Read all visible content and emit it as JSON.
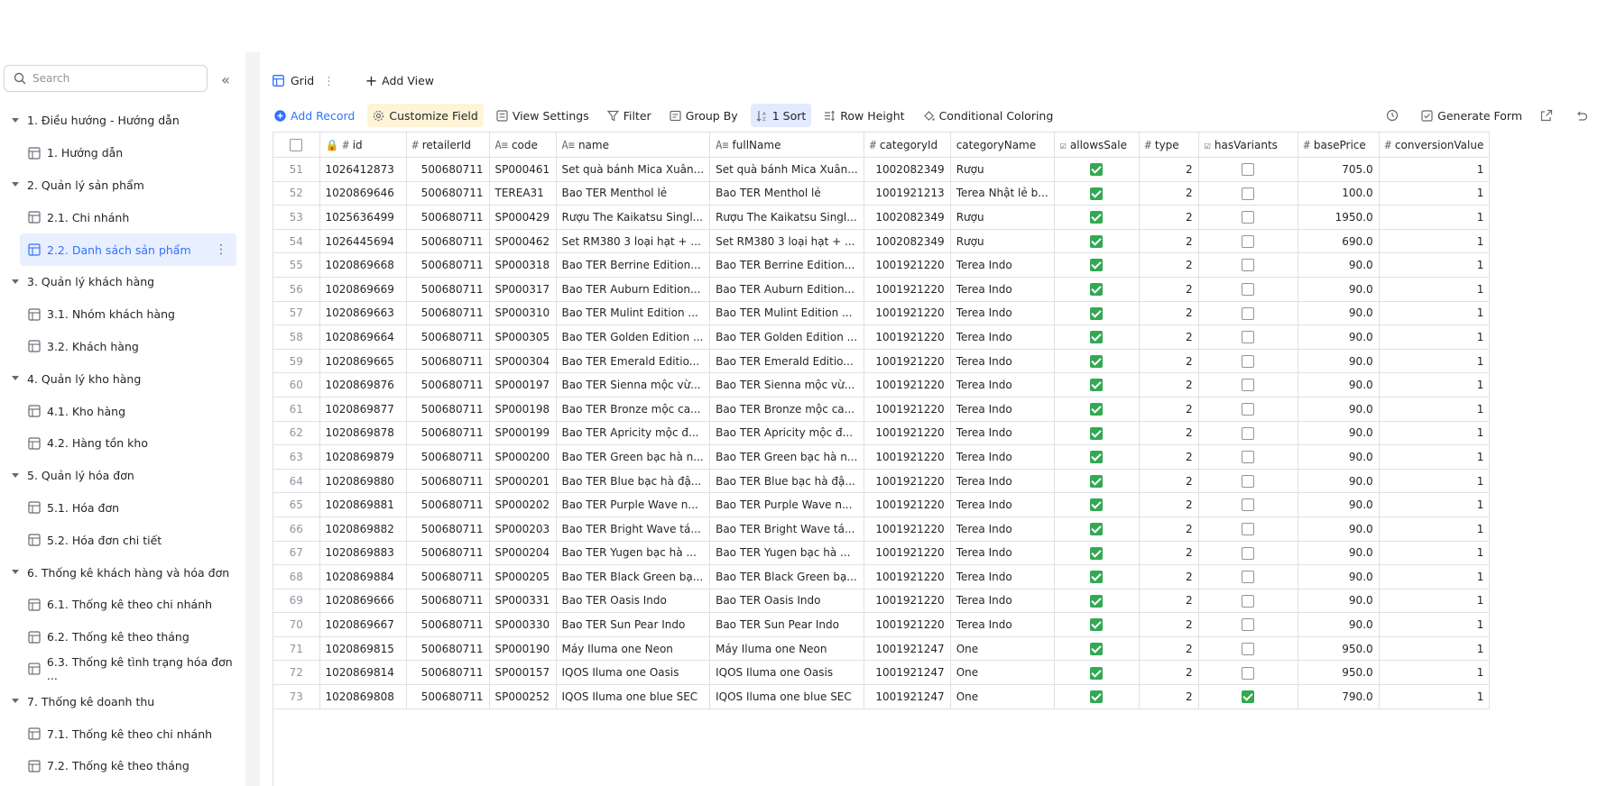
{
  "sidebar": {
    "search_placeholder": "Search",
    "groups": [
      {
        "label": "1. Điều hướng - Hướng dẫn",
        "items": [
          "1. Hướng dẫn"
        ]
      },
      {
        "label": "2. Quản lý sản phẩm",
        "items": [
          "2.1. Chi nhánh",
          "2.2. Danh sách sản phẩm"
        ]
      },
      {
        "label": "3. Quản lý khách hàng",
        "items": [
          "3.1. Nhóm khách hàng",
          "3.2. Khách hàng"
        ]
      },
      {
        "label": "4. Quản lý kho hàng",
        "items": [
          "4.1. Kho hàng",
          "4.2. Hàng tồn kho"
        ]
      },
      {
        "label": "5. Quản lý hóa đơn",
        "items": [
          "5.1. Hóa đơn",
          "5.2. Hóa đơn chi tiết"
        ]
      },
      {
        "label": "6. Thống kê khách hàng và hóa đơn",
        "items": [
          "6.1. Thống kê theo chi nhánh",
          "6.2. Thống kê theo tháng",
          "6.3. Thống kê tình trạng hóa đơn ..."
        ]
      },
      {
        "label": "7. Thống kê doanh thu",
        "items": [
          "7.1. Thống kê theo chi nhánh",
          "7.2. Thống kê theo tháng"
        ]
      }
    ],
    "active_item": "2.2. Danh sách sản phẩm"
  },
  "tabs": {
    "grid": "Grid",
    "add_view": "Add View"
  },
  "toolbar": {
    "add_record": "Add Record",
    "customize_field": "Customize Field",
    "view_settings": "View Settings",
    "filter": "Filter",
    "group_by": "Group By",
    "sort": "1 Sort",
    "row_height": "Row Height",
    "conditional_coloring": "Conditional Coloring",
    "generate_form": "Generate Form"
  },
  "columns": [
    "id",
    "retailerId",
    "code",
    "name",
    "fullName",
    "categoryId",
    "categoryName",
    "allowsSale",
    "type",
    "hasVariants",
    "basePrice",
    "conversionValue"
  ],
  "rows": [
    {
      "n": "51",
      "id": "1026412873",
      "retailerId": "500680711",
      "code": "SP000461",
      "name": "Set quà bánh Mica Xuân...",
      "fullName": "Set quà bánh Mica Xuân...",
      "categoryId": "1002082349",
      "categoryName": "Rượu",
      "allowsSale": true,
      "type": "2",
      "hasVariants": false,
      "basePrice": "705.0",
      "conversionValue": "1"
    },
    {
      "n": "52",
      "id": "1020869646",
      "retailerId": "500680711",
      "code": "TEREA31",
      "name": "Bao TER Menthol lẻ",
      "fullName": "Bao TER Menthol lẻ",
      "categoryId": "1001921213",
      "categoryName": "Terea Nhật lẻ b...",
      "allowsSale": true,
      "type": "2",
      "hasVariants": false,
      "basePrice": "100.0",
      "conversionValue": "1"
    },
    {
      "n": "53",
      "id": "1025636499",
      "retailerId": "500680711",
      "code": "SP000429",
      "name": "Rượu The Kaikatsu Singl...",
      "fullName": "Rượu The Kaikatsu Singl...",
      "categoryId": "1002082349",
      "categoryName": "Rượu",
      "allowsSale": true,
      "type": "2",
      "hasVariants": false,
      "basePrice": "1950.0",
      "conversionValue": "1"
    },
    {
      "n": "54",
      "id": "1026445694",
      "retailerId": "500680711",
      "code": "SP000462",
      "name": "Set RM380 3 loại hạt + ...",
      "fullName": "Set RM380 3 loại hạt + ...",
      "categoryId": "1002082349",
      "categoryName": "Rượu",
      "allowsSale": true,
      "type": "2",
      "hasVariants": false,
      "basePrice": "690.0",
      "conversionValue": "1"
    },
    {
      "n": "55",
      "id": "1020869668",
      "retailerId": "500680711",
      "code": "SP000318",
      "name": "Bao TER Berrine Edition...",
      "fullName": "Bao TER Berrine Edition...",
      "categoryId": "1001921220",
      "categoryName": "Terea Indo",
      "allowsSale": true,
      "type": "2",
      "hasVariants": false,
      "basePrice": "90.0",
      "conversionValue": "1"
    },
    {
      "n": "56",
      "id": "1020869669",
      "retailerId": "500680711",
      "code": "SP000317",
      "name": "Bao TER Auburn Edition...",
      "fullName": "Bao TER Auburn Edition...",
      "categoryId": "1001921220",
      "categoryName": "Terea Indo",
      "allowsSale": true,
      "type": "2",
      "hasVariants": false,
      "basePrice": "90.0",
      "conversionValue": "1"
    },
    {
      "n": "57",
      "id": "1020869663",
      "retailerId": "500680711",
      "code": "SP000310",
      "name": "Bao TER Mulint Edition ...",
      "fullName": "Bao TER Mulint Edition ...",
      "categoryId": "1001921220",
      "categoryName": "Terea Indo",
      "allowsSale": true,
      "type": "2",
      "hasVariants": false,
      "basePrice": "90.0",
      "conversionValue": "1"
    },
    {
      "n": "58",
      "id": "1020869664",
      "retailerId": "500680711",
      "code": "SP000305",
      "name": "Bao TER Golden Edition ...",
      "fullName": "Bao TER Golden Edition ...",
      "categoryId": "1001921220",
      "categoryName": "Terea Indo",
      "allowsSale": true,
      "type": "2",
      "hasVariants": false,
      "basePrice": "90.0",
      "conversionValue": "1"
    },
    {
      "n": "59",
      "id": "1020869665",
      "retailerId": "500680711",
      "code": "SP000304",
      "name": "Bao TER Emerald Editio...",
      "fullName": "Bao TER Emerald Editio...",
      "categoryId": "1001921220",
      "categoryName": "Terea Indo",
      "allowsSale": true,
      "type": "2",
      "hasVariants": false,
      "basePrice": "90.0",
      "conversionValue": "1"
    },
    {
      "n": "60",
      "id": "1020869876",
      "retailerId": "500680711",
      "code": "SP000197",
      "name": "Bao TER Sienna mộc vừ...",
      "fullName": "Bao TER Sienna mộc vừ...",
      "categoryId": "1001921220",
      "categoryName": "Terea Indo",
      "allowsSale": true,
      "type": "2",
      "hasVariants": false,
      "basePrice": "90.0",
      "conversionValue": "1"
    },
    {
      "n": "61",
      "id": "1020869877",
      "retailerId": "500680711",
      "code": "SP000198",
      "name": "Bao TER Bronze mộc ca...",
      "fullName": "Bao TER Bronze mộc ca...",
      "categoryId": "1001921220",
      "categoryName": "Terea Indo",
      "allowsSale": true,
      "type": "2",
      "hasVariants": false,
      "basePrice": "90.0",
      "conversionValue": "1"
    },
    {
      "n": "62",
      "id": "1020869878",
      "retailerId": "500680711",
      "code": "SP000199",
      "name": "Bao TER Apricity mộc đ...",
      "fullName": "Bao TER Apricity mộc đ...",
      "categoryId": "1001921220",
      "categoryName": "Terea Indo",
      "allowsSale": true,
      "type": "2",
      "hasVariants": false,
      "basePrice": "90.0",
      "conversionValue": "1"
    },
    {
      "n": "63",
      "id": "1020869879",
      "retailerId": "500680711",
      "code": "SP000200",
      "name": "Bao TER Green bạc hà n...",
      "fullName": "Bao TER Green bạc hà n...",
      "categoryId": "1001921220",
      "categoryName": "Terea Indo",
      "allowsSale": true,
      "type": "2",
      "hasVariants": false,
      "basePrice": "90.0",
      "conversionValue": "1"
    },
    {
      "n": "64",
      "id": "1020869880",
      "retailerId": "500680711",
      "code": "SP000201",
      "name": "Bao TER Blue bạc hà đậ...",
      "fullName": "Bao TER Blue bạc hà đậ...",
      "categoryId": "1001921220",
      "categoryName": "Terea Indo",
      "allowsSale": true,
      "type": "2",
      "hasVariants": false,
      "basePrice": "90.0",
      "conversionValue": "1"
    },
    {
      "n": "65",
      "id": "1020869881",
      "retailerId": "500680711",
      "code": "SP000202",
      "name": "Bao TER Purple Wave n...",
      "fullName": "Bao TER Purple Wave n...",
      "categoryId": "1001921220",
      "categoryName": "Terea Indo",
      "allowsSale": true,
      "type": "2",
      "hasVariants": false,
      "basePrice": "90.0",
      "conversionValue": "1"
    },
    {
      "n": "66",
      "id": "1020869882",
      "retailerId": "500680711",
      "code": "SP000203",
      "name": "Bao TER Bright Wave tá...",
      "fullName": "Bao TER Bright Wave tá...",
      "categoryId": "1001921220",
      "categoryName": "Terea Indo",
      "allowsSale": true,
      "type": "2",
      "hasVariants": false,
      "basePrice": "90.0",
      "conversionValue": "1"
    },
    {
      "n": "67",
      "id": "1020869883",
      "retailerId": "500680711",
      "code": "SP000204",
      "name": "Bao TER Yugen bạc hà ...",
      "fullName": "Bao TER Yugen bạc hà ...",
      "categoryId": "1001921220",
      "categoryName": "Terea Indo",
      "allowsSale": true,
      "type": "2",
      "hasVariants": false,
      "basePrice": "90.0",
      "conversionValue": "1"
    },
    {
      "n": "68",
      "id": "1020869884",
      "retailerId": "500680711",
      "code": "SP000205",
      "name": "Bao TER Black Green bạ...",
      "fullName": "Bao TER Black Green bạ...",
      "categoryId": "1001921220",
      "categoryName": "Terea Indo",
      "allowsSale": true,
      "type": "2",
      "hasVariants": false,
      "basePrice": "90.0",
      "conversionValue": "1"
    },
    {
      "n": "69",
      "id": "1020869666",
      "retailerId": "500680711",
      "code": "SP000331",
      "name": "Bao TER Oasis Indo",
      "fullName": "Bao TER Oasis Indo",
      "categoryId": "1001921220",
      "categoryName": "Terea Indo",
      "allowsSale": true,
      "type": "2",
      "hasVariants": false,
      "basePrice": "90.0",
      "conversionValue": "1"
    },
    {
      "n": "70",
      "id": "1020869667",
      "retailerId": "500680711",
      "code": "SP000330",
      "name": "Bao TER Sun Pear Indo",
      "fullName": "Bao TER Sun Pear Indo",
      "categoryId": "1001921220",
      "categoryName": "Terea Indo",
      "allowsSale": true,
      "type": "2",
      "hasVariants": false,
      "basePrice": "90.0",
      "conversionValue": "1"
    },
    {
      "n": "71",
      "id": "1020869815",
      "retailerId": "500680711",
      "code": "SP000190",
      "name": "Máy Iluma one Neon",
      "fullName": "Máy Iluma one Neon",
      "categoryId": "1001921247",
      "categoryName": "One",
      "allowsSale": true,
      "type": "2",
      "hasVariants": false,
      "basePrice": "950.0",
      "conversionValue": "1"
    },
    {
      "n": "72",
      "id": "1020869814",
      "retailerId": "500680711",
      "code": "SP000157",
      "name": "IQOS Iluma one Oasis",
      "fullName": "IQOS Iluma one Oasis",
      "categoryId": "1001921247",
      "categoryName": "One",
      "allowsSale": true,
      "type": "2",
      "hasVariants": false,
      "basePrice": "950.0",
      "conversionValue": "1"
    },
    {
      "n": "73",
      "id": "1020869808",
      "retailerId": "500680711",
      "code": "SP000252",
      "name": "IQOS Iluma one blue SEC",
      "fullName": "IQOS Iluma one blue SEC",
      "categoryId": "1001921247",
      "categoryName": "One",
      "allowsSale": true,
      "type": "2",
      "hasVariants": true,
      "basePrice": "790.0",
      "conversionValue": "1"
    }
  ]
}
